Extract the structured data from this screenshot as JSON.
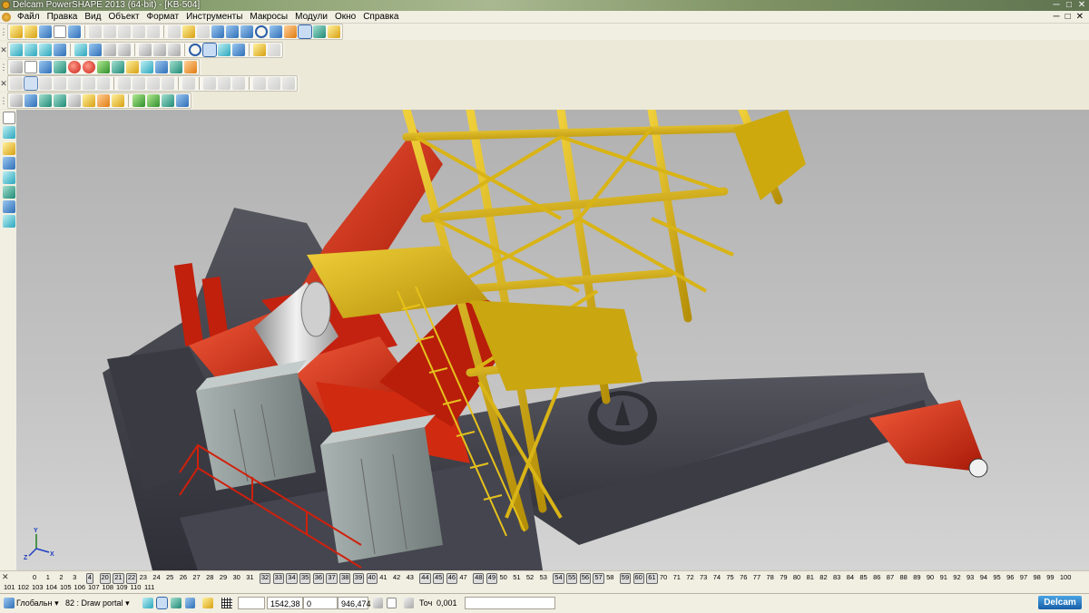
{
  "window": {
    "title": "Delcam PowerSHAPE 2013 (64-bit) - [KB-504]",
    "buttons": [
      "─",
      "□",
      "✕"
    ]
  },
  "menu": {
    "items": [
      "Файл",
      "Правка",
      "Вид",
      "Объект",
      "Формат",
      "Инструменты",
      "Макросы",
      "Модули",
      "Окно",
      "Справка"
    ],
    "doc_buttons": [
      "─",
      "□",
      "✕"
    ]
  },
  "viewport": {
    "axis_labels": {
      "x": "X",
      "y": "Y",
      "z": "Z"
    },
    "background_top": "#b1b1b1",
    "background_bottom": "#d4d4d4",
    "colors": {
      "crane_yellow": "#d8b50c",
      "mechanism_red": "#d4260c",
      "base_dark": "#45454e",
      "cabinet_grey": "#8f9a98",
      "drum_grey": "#d8d8d8"
    }
  },
  "levels": {
    "row1": [
      "0",
      "1",
      "2",
      "3",
      "4",
      "20",
      "21",
      "22",
      "23",
      "24",
      "25",
      "26",
      "27",
      "28",
      "29",
      "30",
      "31",
      "32",
      "33",
      "34",
      "35",
      "36",
      "37",
      "38",
      "39",
      "40",
      "41",
      "42",
      "43",
      "44",
      "45",
      "46",
      "47",
      "48",
      "49",
      "50",
      "51",
      "52",
      "53",
      "54",
      "55",
      "56",
      "57",
      "58",
      "59",
      "60",
      "61",
      "70",
      "71",
      "72",
      "73",
      "74",
      "75",
      "76",
      "77",
      "78",
      "79",
      "80",
      "81",
      "82",
      "83",
      "84",
      "85",
      "86",
      "87",
      "88",
      "89",
      "90",
      "91",
      "92",
      "93",
      "94",
      "95",
      "96",
      "97",
      "98",
      "99",
      "100"
    ],
    "boxed": [
      "4",
      "20",
      "21",
      "22",
      "32",
      "33",
      "34",
      "35",
      "36",
      "37",
      "38",
      "39",
      "40",
      "44",
      "45",
      "46",
      "48",
      "49",
      "54",
      "55",
      "56",
      "57",
      "59",
      "60",
      "61"
    ],
    "row2": [
      "101",
      "102",
      "103",
      "104",
      "105",
      "106",
      "107",
      "108",
      "109",
      "110",
      "111"
    ]
  },
  "status": {
    "workplane": "Глобальн",
    "level_num": "82",
    "level_name": ": Draw portal",
    "coord_x": "1542,38",
    "coord_y": "0",
    "coord_z": "946,474",
    "tolerance_label": "Точ",
    "tolerance_value": "0,001",
    "logo": "Delcam"
  }
}
